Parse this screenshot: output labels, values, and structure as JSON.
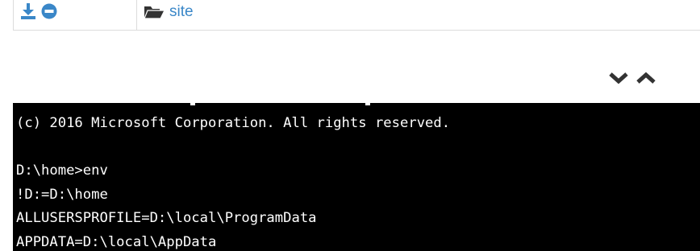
{
  "file_row": {
    "actions": [
      {
        "icon": "download-icon"
      },
      {
        "icon": "minus-circle-icon"
      }
    ],
    "folder_icon": "folder-open-icon",
    "folder_name": "site"
  },
  "console_controls": {
    "collapse_icon": "chevron-down-icon",
    "expand_icon": "chevron-up-icon"
  },
  "console": {
    "lines": [
      "(c) 2016 Microsoft Corporation. All rights reserved.",
      "",
      "D:\\home>env",
      "!D:=D:\\home",
      "ALLUSERSPROFILE=D:\\local\\ProgramData",
      "APPDATA=D:\\local\\AppData"
    ]
  },
  "colors": {
    "link": "#3a87c8",
    "icon_blue": "#3a87c8",
    "chevron": "#333333",
    "console_bg": "#000000",
    "console_fg": "#ffffff",
    "border": "#dcdcdc"
  }
}
